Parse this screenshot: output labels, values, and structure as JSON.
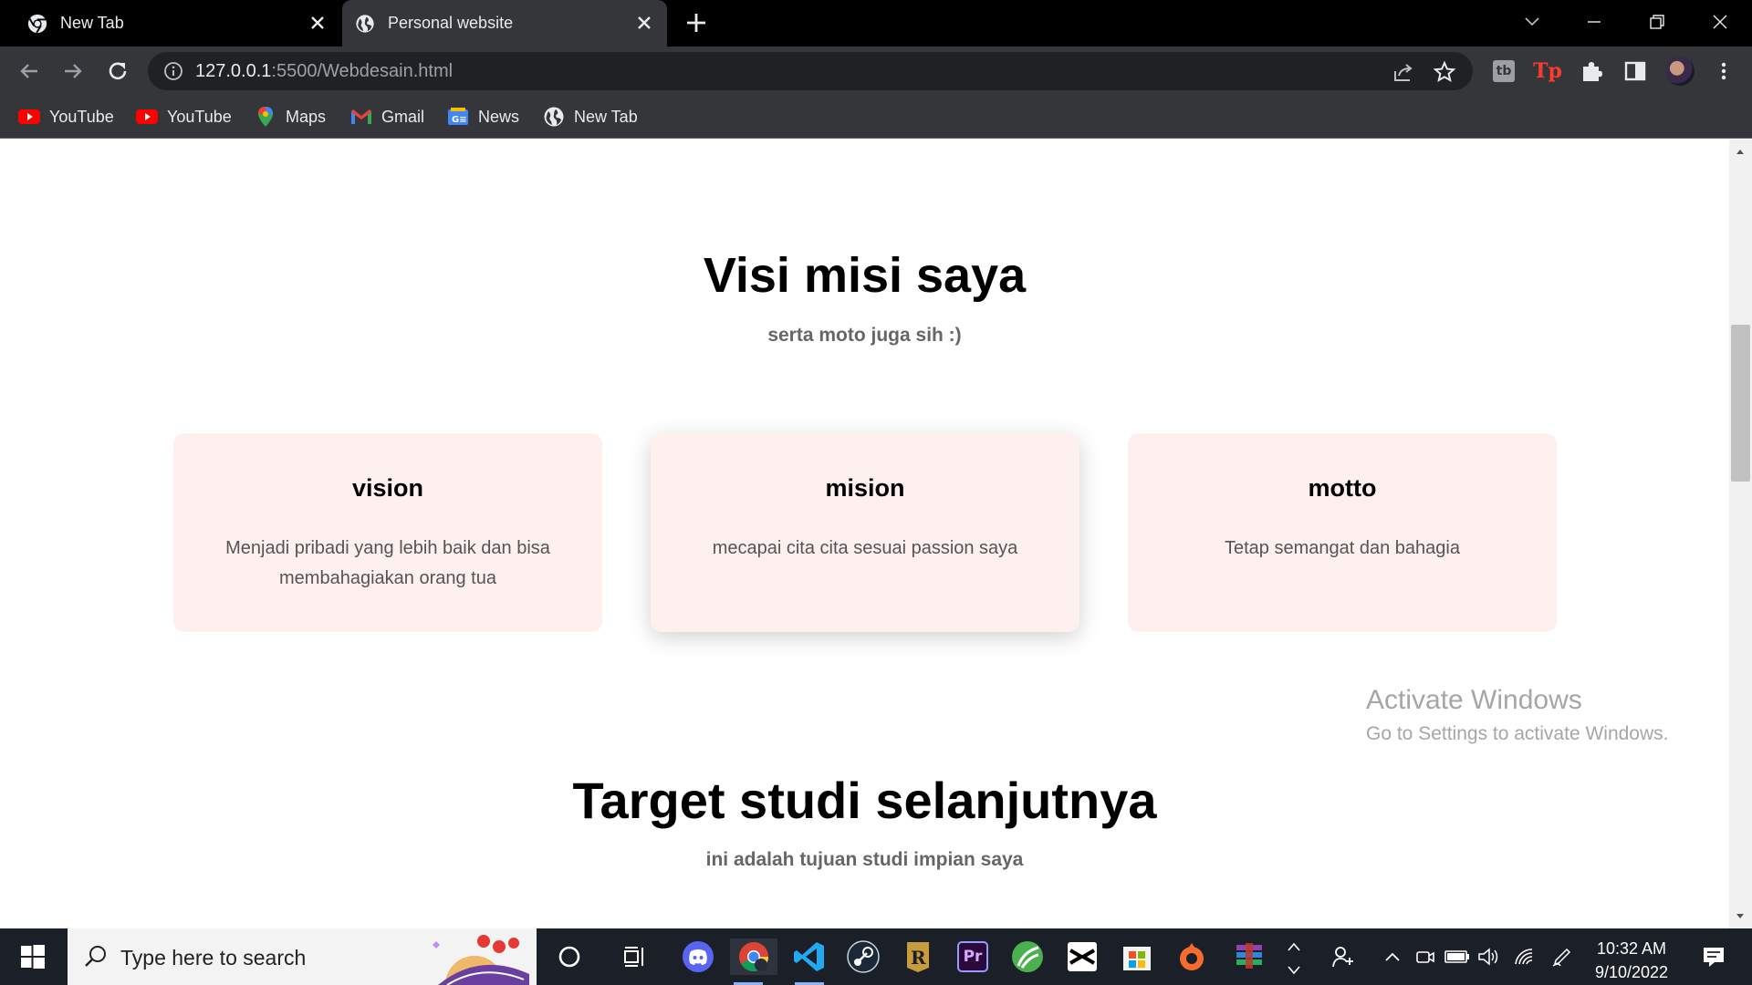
{
  "browser": {
    "tabs": [
      {
        "title": "New Tab",
        "active": false
      },
      {
        "title": "Personal website",
        "active": true
      }
    ],
    "address": {
      "host": "127.0.0.1",
      "rest": ":5500/Webdesain.html"
    },
    "bookmarks": [
      {
        "label": "YouTube",
        "icon": "youtube-icon"
      },
      {
        "label": "YouTube",
        "icon": "youtube-icon"
      },
      {
        "label": "Maps",
        "icon": "maps-icon"
      },
      {
        "label": "Gmail",
        "icon": "gmail-icon"
      },
      {
        "label": "News",
        "icon": "news-icon"
      },
      {
        "label": "New Tab",
        "icon": "globe-icon"
      }
    ]
  },
  "page": {
    "section1": {
      "title": "Visi misi saya",
      "subtitle": "serta moto juga sih :)",
      "cards": [
        {
          "title": "vision",
          "text": "Menjadi pribadi yang lebih baik dan bisa membahagiakan orang tua"
        },
        {
          "title": "mision",
          "text": "mecapai cita cita sesuai passion saya"
        },
        {
          "title": "motto",
          "text": "Tetap semangat dan bahagia"
        }
      ]
    },
    "section2": {
      "title": "Target studi selanjutnya",
      "subtitle": "ini adalah tujuan studi impian saya"
    }
  },
  "watermark": {
    "line1": "Activate Windows",
    "line2": "Go to Settings to activate Windows."
  },
  "taskbar": {
    "search_placeholder": "Type here to search",
    "apps": [
      "cortana-icon",
      "task-view-icon",
      "discord-icon",
      "chrome-icon",
      "vscode-icon",
      "steam-icon",
      "riot-icon",
      "premiere-icon",
      "green-app-icon",
      "capcut-icon",
      "store-icon",
      "origin-icon",
      "winrar-icon"
    ],
    "time": "10:32 AM",
    "date": "9/10/2022"
  },
  "colors": {
    "card_bg": "#fdf0ef",
    "chrome_dark": "#35363a",
    "taskbar": "#1b1f27"
  }
}
